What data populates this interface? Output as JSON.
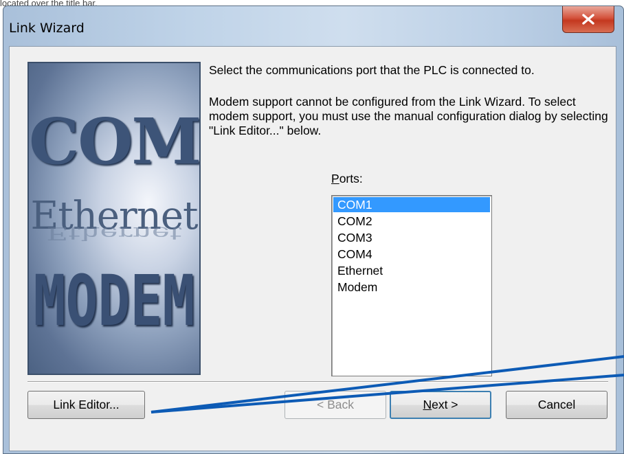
{
  "top_strip_text": "located over the title bar.",
  "window": {
    "title": "Link Wizard",
    "close_glyph": "x"
  },
  "side_image": {
    "word_com": "COM",
    "word_ethernet": "Ethernet",
    "word_modem": "MODEM"
  },
  "content": {
    "intro": "Select the communications port that the PLC is connected to.",
    "modem_note": "Modem support cannot be configured from the Link Wizard. To select modem support, you must use the manual configuration dialog by selecting \"Link Editor...\" below.",
    "ports_label_mnemonic": "P",
    "ports_label_rest": "orts:"
  },
  "ports": {
    "items": [
      "COM1",
      "COM2",
      "COM3",
      "COM4",
      "Ethernet",
      "Modem"
    ],
    "selected": "COM1"
  },
  "buttons": {
    "link_editor": "Link Editor...",
    "back": "< Back",
    "next_mnemonic": "N",
    "next_rest": "ext >",
    "cancel": "Cancel"
  },
  "annotation": {
    "color": "#0d5bb5"
  },
  "colors": {
    "selection": "#3399ff",
    "close_button": "#c4381f"
  }
}
